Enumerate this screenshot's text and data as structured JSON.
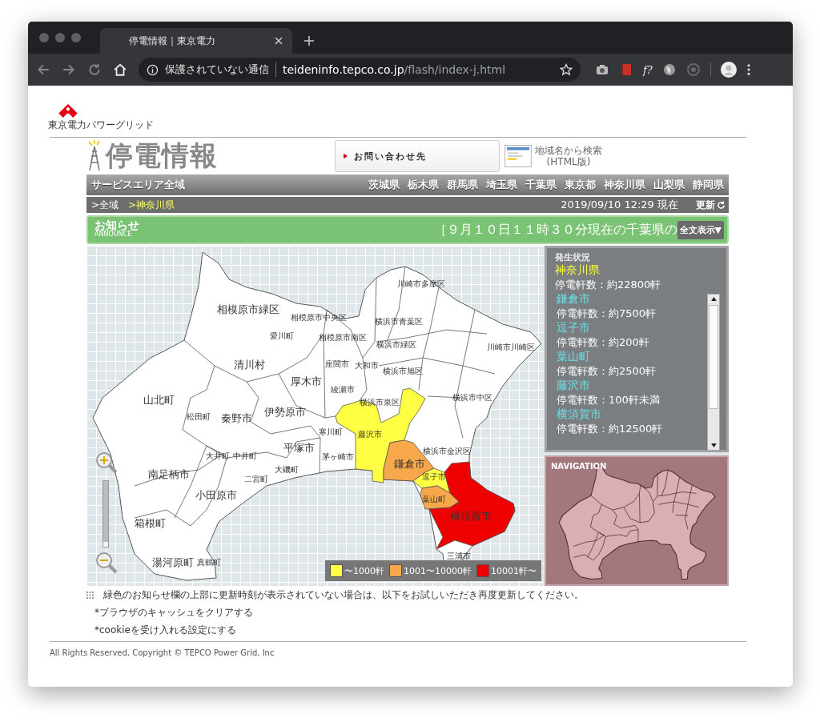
{
  "browser": {
    "tab_title": "停電情報｜東京電力",
    "security_label": "保護されていない通信",
    "url_host": "teideninfo.tepco.co.jp",
    "url_path": "/flash/index-j.html",
    "extension_label": "f?"
  },
  "logo": {
    "caption": "東京電力パワーグリッド"
  },
  "header": {
    "title": "停電情報",
    "contact_button": "お問い合わせ先",
    "search_link": "地域名から検索",
    "search_sub": "(HTML版)"
  },
  "nav": {
    "all_area": "サービスエリア全域",
    "prefectures": [
      "茨城県",
      "栃木県",
      "群馬県",
      "埼玉県",
      "千葉県",
      "東京都",
      "神奈川県",
      "山梨県",
      "静岡県"
    ]
  },
  "breadcrumb": {
    "items": [
      {
        "label": ">全域",
        "selected": false
      },
      {
        "label": ">神奈川県",
        "selected": true
      }
    ],
    "timestamp": "2019/09/10 12:29 現在",
    "refresh": "更新"
  },
  "announce": {
    "title": "お知らせ",
    "subtitle": "ANNOUNCE",
    "ticker": "［９月１０日１１時３０分現在の千葉県の",
    "full_text_button": "全文表示▼"
  },
  "map": {
    "zoom": {
      "level": 0
    },
    "areas": [
      {
        "name": "相模原市緑区",
        "kind": "large"
      },
      {
        "name": "相模原市中央区",
        "kind": "small"
      },
      {
        "name": "川崎市多摩区",
        "kind": "small"
      },
      {
        "name": "愛川町",
        "kind": "small"
      },
      {
        "name": "相模原市南区",
        "kind": "small"
      },
      {
        "name": "横浜市青葉区",
        "kind": "small"
      },
      {
        "name": "横浜市緑区",
        "kind": "small"
      },
      {
        "name": "川崎市川崎区",
        "kind": "small"
      },
      {
        "name": "清川村",
        "kind": "large"
      },
      {
        "name": "座間市",
        "kind": "small"
      },
      {
        "name": "大和市",
        "kind": "small"
      },
      {
        "name": "横浜市旭区",
        "kind": "small"
      },
      {
        "name": "厚木市",
        "kind": "large"
      },
      {
        "name": "綾瀬市",
        "kind": "small"
      },
      {
        "name": "山北町",
        "kind": "large"
      },
      {
        "name": "横浜市泉区",
        "kind": "small"
      },
      {
        "name": "横浜市中区",
        "kind": "small"
      },
      {
        "name": "伊勢原市",
        "kind": "large"
      },
      {
        "name": "松田町",
        "kind": "small"
      },
      {
        "name": "秦野市",
        "kind": "large"
      },
      {
        "name": "寒川町",
        "kind": "small"
      },
      {
        "name": "藤沢市",
        "kind": "small",
        "color": "#ffff44"
      },
      {
        "name": "平塚市",
        "kind": "large"
      },
      {
        "name": "横浜市金沢区",
        "kind": "small"
      },
      {
        "name": "大井町",
        "kind": "small"
      },
      {
        "name": "中井町",
        "kind": "small"
      },
      {
        "name": "茅ヶ崎市",
        "kind": "small"
      },
      {
        "name": "鎌倉市",
        "kind": "large",
        "color": "#f7a84a"
      },
      {
        "name": "南足柄市",
        "kind": "large"
      },
      {
        "name": "逗子市",
        "kind": "small",
        "color": "#ffff44"
      },
      {
        "name": "大磯町",
        "kind": "small"
      },
      {
        "name": "二宮町",
        "kind": "small"
      },
      {
        "name": "小田原市",
        "kind": "large"
      },
      {
        "name": "葉山町",
        "kind": "small",
        "color": "#f7a84a"
      },
      {
        "name": "横須賀市",
        "kind": "large",
        "color": "#ee0000"
      },
      {
        "name": "箱根町",
        "kind": "large"
      },
      {
        "name": "湯河原町",
        "kind": "large"
      },
      {
        "name": "真鶴町",
        "kind": "small"
      },
      {
        "name": "三浦市",
        "kind": "small"
      }
    ],
    "legend": [
      {
        "label": "〜1000軒",
        "color": "#ffff44"
      },
      {
        "label": "1001〜10000軒",
        "color": "#f7a84a"
      },
      {
        "label": "10001軒〜",
        "color": "#ee0000"
      }
    ]
  },
  "status": {
    "title": "発生状況",
    "prefecture": {
      "name": "神奈川県",
      "count": "停電軒数：約22800軒"
    },
    "cities": [
      {
        "name": "鎌倉市",
        "count": "停電軒数：約7500軒"
      },
      {
        "name": "逗子市",
        "count": "停電軒数：約200軒"
      },
      {
        "name": "葉山町",
        "count": "停電軒数：約2500軒"
      },
      {
        "name": "藤沢市",
        "count": "停電軒数：100軒未満"
      },
      {
        "name": "横須賀市",
        "count": "停電軒数：約12500軒"
      }
    ]
  },
  "navigation": {
    "title": "NAVIGATION"
  },
  "notes": {
    "main": "緑色のお知らせ欄の上部に更新時刻が表示されていない場合は、以下をお試しいただき再度更新してください。",
    "items": [
      "*ブラウザのキャッシュをクリアする",
      "*cookieを受け入れる設定にする"
    ]
  },
  "footer": {
    "copyright": "All Rights Reserved, Copyright © TEPCO Power Grid, Inc"
  }
}
